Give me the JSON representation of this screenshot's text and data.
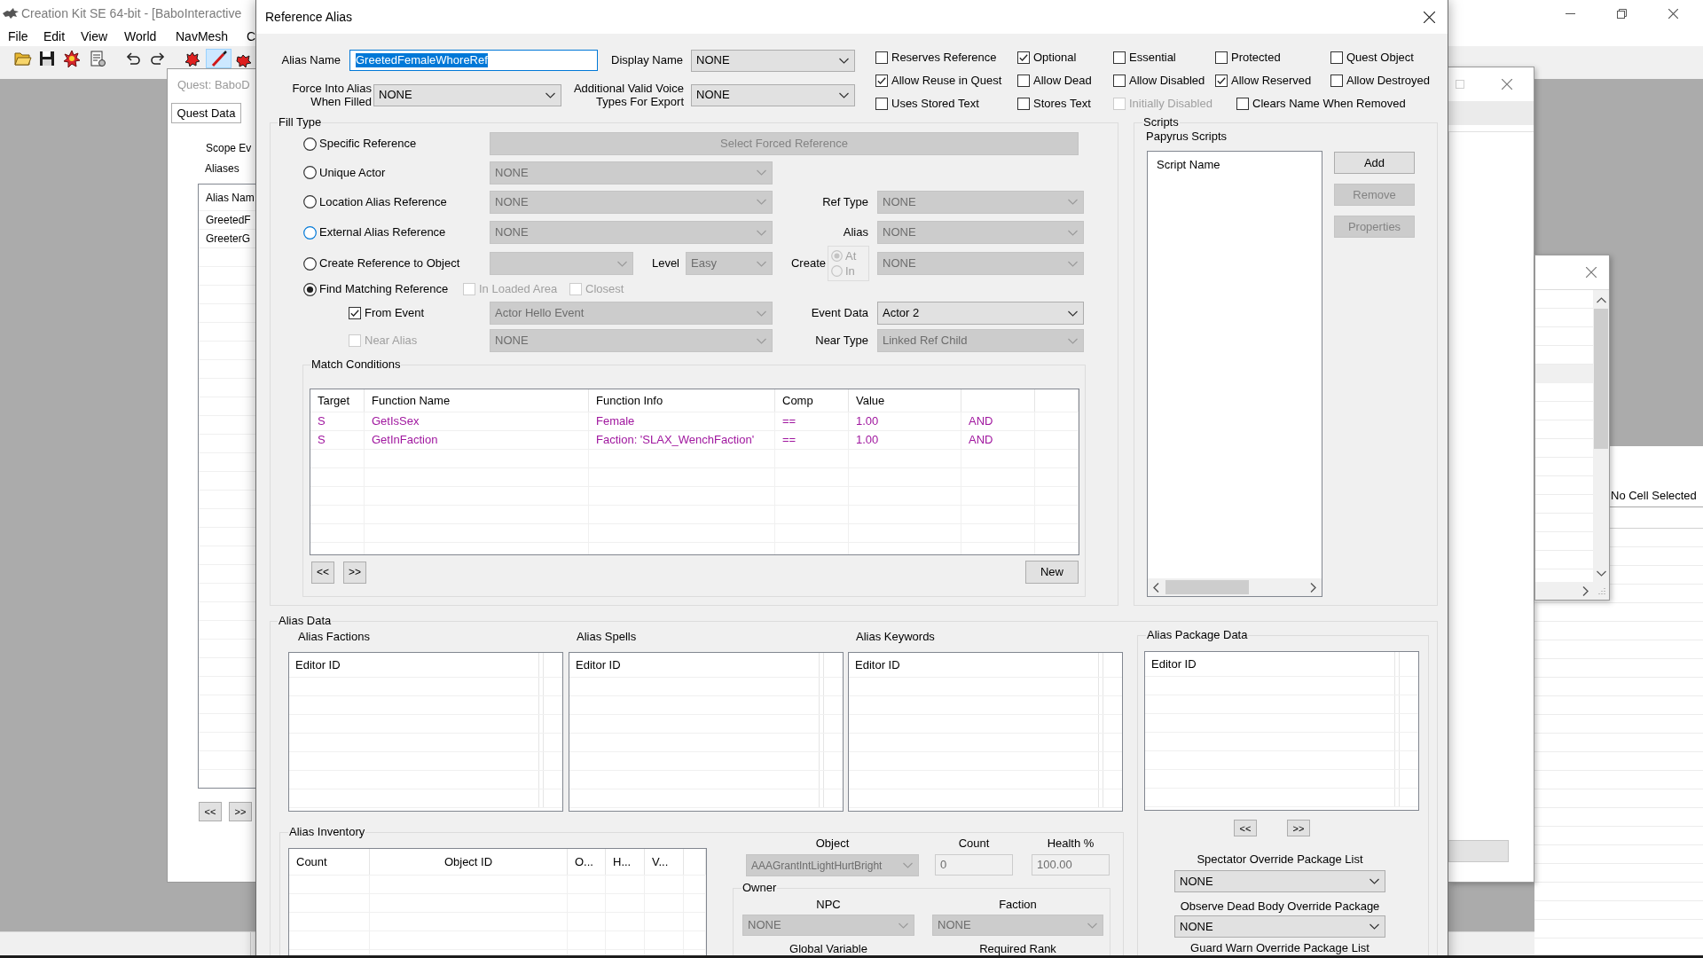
{
  "app": {
    "title": "Creation Kit SE 64-bit - [BaboInteractive",
    "menu": [
      "File",
      "Edit",
      "View",
      "World",
      "NavMesh",
      "C"
    ],
    "toolbar": [
      {
        "kind": "open",
        "pressed": false
      },
      {
        "kind": "save",
        "pressed": false
      },
      {
        "kind": "export",
        "pressed": false
      },
      {
        "kind": "properties",
        "pressed": false
      },
      {
        "kind": "undo",
        "pressed": false
      },
      {
        "kind": "redo",
        "pressed": false
      },
      {
        "kind": "render",
        "pressed": false
      },
      {
        "kind": "brush",
        "pressed": true
      },
      {
        "kind": "local",
        "pressed": false
      }
    ]
  },
  "quest_window": {
    "title": "Quest: BaboD",
    "tabs": [
      {
        "label": "Quest Data",
        "selected": true
      }
    ],
    "scope_label": "Scope Ev",
    "aliases_label": "Aliases",
    "alias_list": {
      "header": "Alias Nam",
      "rows": [
        "GreetedF",
        "GreeterG"
      ]
    },
    "nav_buttons": [
      "<<",
      ">>"
    ]
  },
  "cell_view": {
    "status": "No Cell Selected"
  },
  "dialog": {
    "title": "Reference Alias",
    "alias_name": {
      "label": "Alias Name",
      "value": "GreetedFemaleWhoreRef",
      "text_selected": true
    },
    "display_name": {
      "label": "Display Name",
      "value": "NONE",
      "disabled": false
    },
    "force_into_alias": {
      "label": "Force Into Alias When Filled",
      "value": "NONE",
      "disabled": false
    },
    "voice_types": {
      "label": "Additional Valid Voice Types For Export",
      "value": "NONE",
      "disabled": false
    },
    "flag_rows": [
      [
        {
          "label": "Reserves Reference",
          "checked": false,
          "disabled": false
        },
        {
          "label": "Optional",
          "checked": true,
          "disabled": false
        },
        {
          "label": "Essential",
          "checked": false,
          "disabled": false
        },
        {
          "label": "Protected",
          "checked": false,
          "disabled": false
        },
        {
          "label": "Quest Object",
          "checked": false,
          "disabled": false
        }
      ],
      [
        {
          "label": "Allow Reuse in Quest",
          "checked": true,
          "disabled": false
        },
        {
          "label": "Allow Dead",
          "checked": false,
          "disabled": false
        },
        {
          "label": "Allow Disabled",
          "checked": false,
          "disabled": false
        },
        {
          "label": "Allow Reserved",
          "checked": true,
          "disabled": false
        },
        {
          "label": "Allow Destroyed",
          "checked": false,
          "disabled": false
        }
      ],
      [
        {
          "label": "Uses Stored Text",
          "checked": false,
          "disabled": false
        },
        {
          "label": "Stores Text",
          "checked": false,
          "disabled": false
        },
        {
          "label": "Initially Disabled",
          "checked": false,
          "disabled": true
        },
        {
          "label": "Clears Name When Removed",
          "checked": false,
          "disabled": false
        }
      ]
    ],
    "fill_type": {
      "title": "Fill Type",
      "options": [
        {
          "label": "Specific Reference",
          "selected": false,
          "hovered": false
        },
        {
          "label": "Unique Actor",
          "selected": false,
          "hovered": false
        },
        {
          "label": "Location Alias Reference",
          "selected": false,
          "hovered": false
        },
        {
          "label": "External Alias Reference",
          "selected": false,
          "hovered": true
        },
        {
          "label": "Create Reference to Object",
          "selected": false,
          "hovered": false
        },
        {
          "label": "Find Matching Reference",
          "selected": true,
          "hovered": false
        }
      ],
      "forced_reference_button": {
        "label": "Select Forced Reference",
        "disabled": true
      },
      "unique_actor": {
        "value": "NONE",
        "disabled": true
      },
      "location_alias": {
        "value": "NONE",
        "disabled": true
      },
      "ref_type": {
        "label": "Ref Type",
        "value": "NONE",
        "disabled": true
      },
      "external_alias": {
        "value": "NONE",
        "disabled": true
      },
      "alias": {
        "label": "Alias",
        "value": "NONE",
        "disabled": true
      },
      "object": {
        "disabled": true
      },
      "level": {
        "label": "Level",
        "value": "Easy",
        "disabled": true
      },
      "create": {
        "label": "Create",
        "disabled": true,
        "options": [
          {
            "label": "At",
            "selected": true
          },
          {
            "label": "In",
            "selected": false
          }
        ]
      },
      "create_target": {
        "value": "NONE",
        "disabled": true
      },
      "in_loaded_area": {
        "label": "In Loaded Area",
        "checked": false,
        "disabled": true
      },
      "closest": {
        "label": "Closest",
        "checked": false,
        "disabled": true
      },
      "from_event": {
        "label": "From Event",
        "checked": true,
        "disabled": false
      },
      "event": {
        "value": "Actor Hello Event",
        "disabled": true
      },
      "event_data": {
        "label": "Event Data",
        "value": "Actor 2",
        "disabled": false
      },
      "near_alias": {
        "label": "Near Alias",
        "checked": false,
        "disabled": true
      },
      "near_alias_target": {
        "value": "NONE",
        "disabled": true
      },
      "near_type": {
        "label": "Near Type",
        "value": "Linked Ref Child",
        "disabled": true
      },
      "match_conditions": {
        "title": "Match Conditions",
        "columns": [
          "Target",
          "Function Name",
          "Function Info",
          "Comp",
          "Value"
        ],
        "rows": [
          [
            "S",
            "GetIsSex",
            "Female",
            "==",
            "1.00",
            "AND"
          ],
          [
            "S",
            "GetInFaction",
            "Faction: 'SLAX_WenchFaction'",
            "==",
            "1.00",
            "AND"
          ]
        ],
        "nav_buttons": [
          "<<",
          ">>"
        ],
        "new_button": "New"
      }
    },
    "scripts": {
      "title": "Scripts",
      "subtitle": "Papyrus Scripts",
      "list_header": "Script Name",
      "buttons": [
        {
          "label": "Add",
          "disabled": false
        },
        {
          "label": "Remove",
          "disabled": true
        },
        {
          "label": "Properties",
          "disabled": true
        }
      ]
    },
    "alias_data": {
      "title": "Alias Data",
      "lists": [
        {
          "title": "Alias Factions",
          "header": "Editor ID"
        },
        {
          "title": "Alias Spells",
          "header": "Editor ID"
        },
        {
          "title": "Alias Keywords",
          "header": "Editor ID"
        }
      ],
      "inventory": {
        "title": "Alias Inventory",
        "columns": [
          "Count",
          "Object ID",
          "O...",
          "H...",
          "V..."
        ],
        "object": {
          "label": "Object",
          "value": "AAAGrantIntLightHurtBright",
          "disabled": true
        },
        "count": {
          "label": "Count",
          "value": "0",
          "disabled": true
        },
        "health": {
          "label": "Health %",
          "value": "100.00",
          "disabled": true
        },
        "owner": {
          "title": "Owner",
          "npc": {
            "label": "NPC",
            "value": "NONE",
            "disabled": true
          },
          "faction": {
            "label": "Faction",
            "value": "NONE",
            "disabled": true
          },
          "labels": [
            "Global Variable",
            "Required Rank"
          ]
        }
      },
      "package_data": {
        "title": "Alias Package Data",
        "header": "Editor ID",
        "nav_buttons": [
          "<<",
          ">>"
        ],
        "overrides": [
          {
            "label": "Spectator Override Package List",
            "value": "NONE"
          },
          {
            "label": "Observe Dead Body Override Package",
            "value": "NONE"
          },
          {
            "label": "Guard Warn Override Package List"
          }
        ]
      }
    }
  }
}
